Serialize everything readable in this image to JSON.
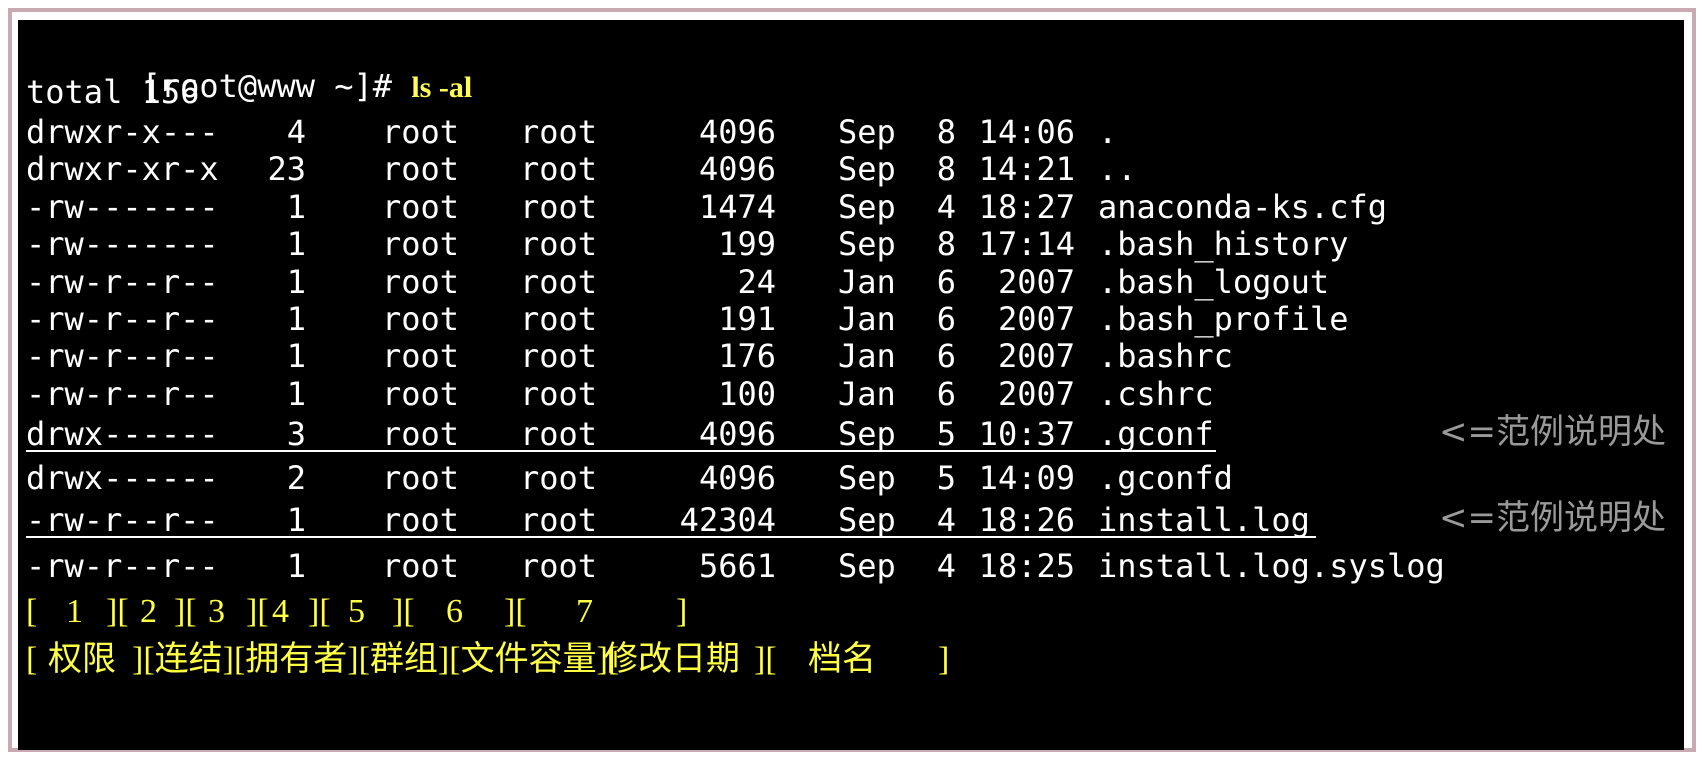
{
  "terminal": {
    "prompt": "[root@www ~]# ",
    "command": "ls -al",
    "total_line": "total 156",
    "entries": [
      {
        "perms": "drwxr-x---",
        "links": "4",
        "owner": "root",
        "group": "root",
        "size": "4096",
        "month": "Sep",
        "day": "8",
        "time": "14:06",
        "name": ".",
        "underline": false
      },
      {
        "perms": "drwxr-xr-x",
        "links": "23",
        "owner": "root",
        "group": "root",
        "size": "4096",
        "month": "Sep",
        "day": "8",
        "time": "14:21",
        "name": "..",
        "underline": false
      },
      {
        "perms": "-rw-------",
        "links": "1",
        "owner": "root",
        "group": "root",
        "size": "1474",
        "month": "Sep",
        "day": "4",
        "time": "18:27",
        "name": "anaconda-ks.cfg",
        "underline": false
      },
      {
        "perms": "-rw-------",
        "links": "1",
        "owner": "root",
        "group": "root",
        "size": "199",
        "month": "Sep",
        "day": "8",
        "time": "17:14",
        "name": ".bash_history",
        "underline": false
      },
      {
        "perms": "-rw-r--r--",
        "links": "1",
        "owner": "root",
        "group": "root",
        "size": "24",
        "month": "Jan",
        "day": "6",
        "time": "2007",
        "name": ".bash_logout",
        "underline": false
      },
      {
        "perms": "-rw-r--r--",
        "links": "1",
        "owner": "root",
        "group": "root",
        "size": "191",
        "month": "Jan",
        "day": "6",
        "time": "2007",
        "name": ".bash_profile",
        "underline": false
      },
      {
        "perms": "-rw-r--r--",
        "links": "1",
        "owner": "root",
        "group": "root",
        "size": "176",
        "month": "Jan",
        "day": "6",
        "time": "2007",
        "name": ".bashrc",
        "underline": false
      },
      {
        "perms": "-rw-r--r--",
        "links": "1",
        "owner": "root",
        "group": "root",
        "size": "100",
        "month": "Jan",
        "day": "6",
        "time": "2007",
        "name": ".cshrc",
        "underline": false
      },
      {
        "perms": "drwx------",
        "links": "3",
        "owner": "root",
        "group": "root",
        "size": "4096",
        "month": "Sep",
        "day": "5",
        "time": "10:37",
        "name": ".gconf",
        "underline": true,
        "note": "<=范例说明处"
      },
      {
        "perms": "drwx------",
        "links": "2",
        "owner": "root",
        "group": "root",
        "size": "4096",
        "month": "Sep",
        "day": "5",
        "time": "14:09",
        "name": ".gconfd",
        "underline": false
      },
      {
        "perms": "-rw-r--r--",
        "links": "1",
        "owner": "root",
        "group": "root",
        "size": "42304",
        "month": "Sep",
        "day": "4",
        "time": "18:26",
        "name": "install.log",
        "underline": true,
        "note": "<=范例说明处"
      },
      {
        "perms": "-rw-r--r--",
        "links": "1",
        "owner": "root",
        "group": "root",
        "size": "5661",
        "month": "Sep",
        "day": "4",
        "time": "18:25",
        "name": "install.log.syslog",
        "underline": false
      }
    ],
    "legend_numbers": [
      "[",
      "1",
      "][",
      "2",
      "][",
      "3",
      "][",
      "4",
      "][",
      "5",
      "][",
      "6",
      "][",
      "7",
      "]"
    ],
    "legend_labels": [
      "[",
      "权限",
      "][连结][拥有者][群组][文件容量][",
      "修改日期",
      "][",
      "档名",
      "]"
    ]
  },
  "colors": {
    "background": "#000000",
    "text": "#ffffff",
    "command": "#ffff55",
    "legend": "#ffff44",
    "note": "#9a9a9a",
    "frame": "#c9aab3"
  }
}
